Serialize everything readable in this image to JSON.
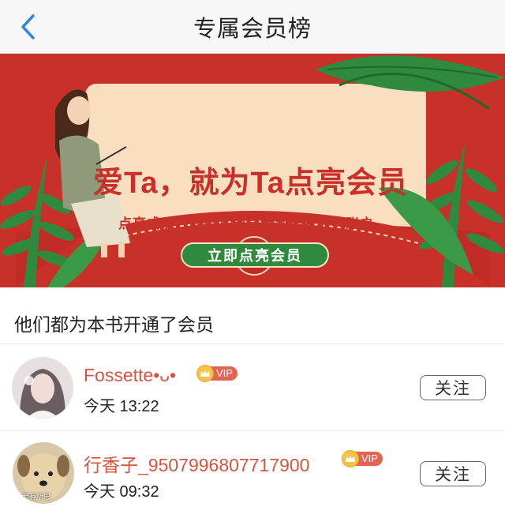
{
  "header": {
    "title": "专属会员榜"
  },
  "banner": {
    "title": "爱Ta，就为Ta点亮会员",
    "subtitle": "点亮成功，收益立刻同步到作者大大账户",
    "button_label": "立即点亮会员"
  },
  "list": {
    "heading": "他们都为本书开通了会员",
    "members": [
      {
        "name": "Fossette•ᴗ•",
        "badge": "VIP",
        "time": "今天 13:22",
        "follow_label": "关注",
        "avatar_watermark": ""
      },
      {
        "name": "行香子_9507996807717900",
        "badge": "VIP",
        "time": "今天 09:32",
        "follow_label": "关注",
        "avatar_watermark": "若有所思"
      }
    ]
  },
  "colors": {
    "banner_red": "#c8302a",
    "accent_green": "#2f8a3d",
    "username_red": "#d9533e",
    "vip_gold": "#f6c445",
    "back_blue": "#2f86e0"
  }
}
